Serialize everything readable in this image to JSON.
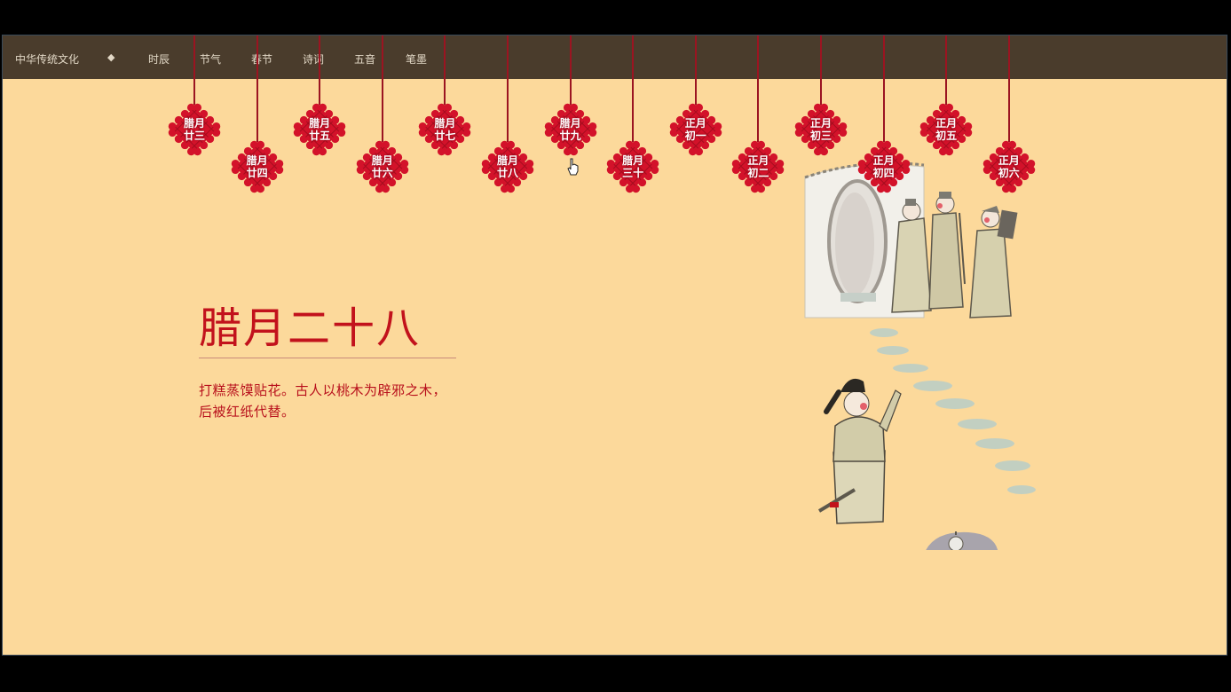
{
  "nav": {
    "items": [
      {
        "label": "中华传统文化",
        "name": "nav-home"
      },
      {
        "label": "◆",
        "name": "nav-diamond"
      },
      {
        "label": "时辰",
        "name": "nav-shichen"
      },
      {
        "label": "节气",
        "name": "nav-jieqi"
      },
      {
        "label": "春节",
        "name": "nav-chunjie"
      },
      {
        "label": "诗词",
        "name": "nav-shici"
      },
      {
        "label": "五音",
        "name": "nav-wuyin"
      },
      {
        "label": "笔墨",
        "name": "nav-bimo"
      }
    ]
  },
  "knots": [
    {
      "line1": "腊月",
      "line2": "廿三"
    },
    {
      "line1": "腊月",
      "line2": "廿四"
    },
    {
      "line1": "腊月",
      "line2": "廿五"
    },
    {
      "line1": "腊月",
      "line2": "廿六"
    },
    {
      "line1": "腊月",
      "line2": "廿七"
    },
    {
      "line1": "腊月",
      "line2": "廿八"
    },
    {
      "line1": "腊月",
      "line2": "廿九"
    },
    {
      "line1": "腊月",
      "line2": "三十"
    },
    {
      "line1": "正月",
      "line2": "初一"
    },
    {
      "line1": "正月",
      "line2": "初二"
    },
    {
      "line1": "正月",
      "line2": "初三"
    },
    {
      "line1": "正月",
      "line2": "初四"
    },
    {
      "line1": "正月",
      "line2": "初五"
    },
    {
      "line1": "正月",
      "line2": "初六"
    }
  ],
  "main": {
    "title": "腊月二十八",
    "description": "打糕蒸馍贴花。古人以桃木为辟邪之木，后被红纸代替。"
  },
  "colors": {
    "background": "#fcd99b",
    "nav": "#4a3c2c",
    "accent_red": "#c2121c",
    "knot_red": "#d3122a"
  }
}
